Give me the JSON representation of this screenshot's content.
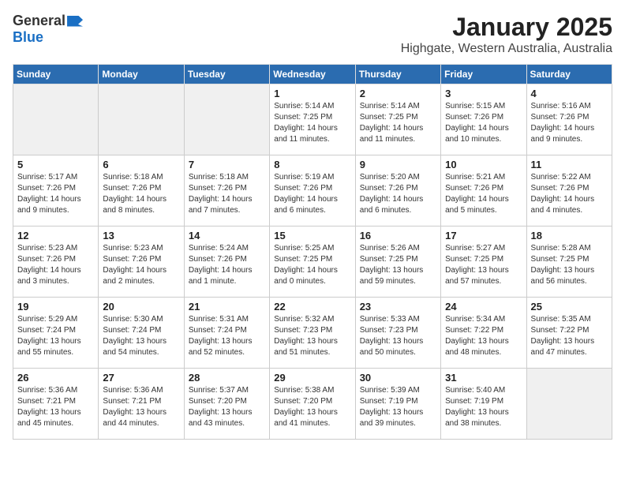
{
  "logo": {
    "general": "General",
    "blue": "Blue"
  },
  "header": {
    "month": "January 2025",
    "location": "Highgate, Western Australia, Australia"
  },
  "weekdays": [
    "Sunday",
    "Monday",
    "Tuesday",
    "Wednesday",
    "Thursday",
    "Friday",
    "Saturday"
  ],
  "weeks": [
    [
      {
        "day": "",
        "content": ""
      },
      {
        "day": "",
        "content": ""
      },
      {
        "day": "",
        "content": ""
      },
      {
        "day": "1",
        "content": "Sunrise: 5:14 AM\nSunset: 7:25 PM\nDaylight: 14 hours\nand 11 minutes."
      },
      {
        "day": "2",
        "content": "Sunrise: 5:14 AM\nSunset: 7:25 PM\nDaylight: 14 hours\nand 11 minutes."
      },
      {
        "day": "3",
        "content": "Sunrise: 5:15 AM\nSunset: 7:26 PM\nDaylight: 14 hours\nand 10 minutes."
      },
      {
        "day": "4",
        "content": "Sunrise: 5:16 AM\nSunset: 7:26 PM\nDaylight: 14 hours\nand 9 minutes."
      }
    ],
    [
      {
        "day": "5",
        "content": "Sunrise: 5:17 AM\nSunset: 7:26 PM\nDaylight: 14 hours\nand 9 minutes."
      },
      {
        "day": "6",
        "content": "Sunrise: 5:18 AM\nSunset: 7:26 PM\nDaylight: 14 hours\nand 8 minutes."
      },
      {
        "day": "7",
        "content": "Sunrise: 5:18 AM\nSunset: 7:26 PM\nDaylight: 14 hours\nand 7 minutes."
      },
      {
        "day": "8",
        "content": "Sunrise: 5:19 AM\nSunset: 7:26 PM\nDaylight: 14 hours\nand 6 minutes."
      },
      {
        "day": "9",
        "content": "Sunrise: 5:20 AM\nSunset: 7:26 PM\nDaylight: 14 hours\nand 6 minutes."
      },
      {
        "day": "10",
        "content": "Sunrise: 5:21 AM\nSunset: 7:26 PM\nDaylight: 14 hours\nand 5 minutes."
      },
      {
        "day": "11",
        "content": "Sunrise: 5:22 AM\nSunset: 7:26 PM\nDaylight: 14 hours\nand 4 minutes."
      }
    ],
    [
      {
        "day": "12",
        "content": "Sunrise: 5:23 AM\nSunset: 7:26 PM\nDaylight: 14 hours\nand 3 minutes."
      },
      {
        "day": "13",
        "content": "Sunrise: 5:23 AM\nSunset: 7:26 PM\nDaylight: 14 hours\nand 2 minutes."
      },
      {
        "day": "14",
        "content": "Sunrise: 5:24 AM\nSunset: 7:26 PM\nDaylight: 14 hours\nand 1 minute."
      },
      {
        "day": "15",
        "content": "Sunrise: 5:25 AM\nSunset: 7:25 PM\nDaylight: 14 hours\nand 0 minutes."
      },
      {
        "day": "16",
        "content": "Sunrise: 5:26 AM\nSunset: 7:25 PM\nDaylight: 13 hours\nand 59 minutes."
      },
      {
        "day": "17",
        "content": "Sunrise: 5:27 AM\nSunset: 7:25 PM\nDaylight: 13 hours\nand 57 minutes."
      },
      {
        "day": "18",
        "content": "Sunrise: 5:28 AM\nSunset: 7:25 PM\nDaylight: 13 hours\nand 56 minutes."
      }
    ],
    [
      {
        "day": "19",
        "content": "Sunrise: 5:29 AM\nSunset: 7:24 PM\nDaylight: 13 hours\nand 55 minutes."
      },
      {
        "day": "20",
        "content": "Sunrise: 5:30 AM\nSunset: 7:24 PM\nDaylight: 13 hours\nand 54 minutes."
      },
      {
        "day": "21",
        "content": "Sunrise: 5:31 AM\nSunset: 7:24 PM\nDaylight: 13 hours\nand 52 minutes."
      },
      {
        "day": "22",
        "content": "Sunrise: 5:32 AM\nSunset: 7:23 PM\nDaylight: 13 hours\nand 51 minutes."
      },
      {
        "day": "23",
        "content": "Sunrise: 5:33 AM\nSunset: 7:23 PM\nDaylight: 13 hours\nand 50 minutes."
      },
      {
        "day": "24",
        "content": "Sunrise: 5:34 AM\nSunset: 7:22 PM\nDaylight: 13 hours\nand 48 minutes."
      },
      {
        "day": "25",
        "content": "Sunrise: 5:35 AM\nSunset: 7:22 PM\nDaylight: 13 hours\nand 47 minutes."
      }
    ],
    [
      {
        "day": "26",
        "content": "Sunrise: 5:36 AM\nSunset: 7:21 PM\nDaylight: 13 hours\nand 45 minutes."
      },
      {
        "day": "27",
        "content": "Sunrise: 5:36 AM\nSunset: 7:21 PM\nDaylight: 13 hours\nand 44 minutes."
      },
      {
        "day": "28",
        "content": "Sunrise: 5:37 AM\nSunset: 7:20 PM\nDaylight: 13 hours\nand 43 minutes."
      },
      {
        "day": "29",
        "content": "Sunrise: 5:38 AM\nSunset: 7:20 PM\nDaylight: 13 hours\nand 41 minutes."
      },
      {
        "day": "30",
        "content": "Sunrise: 5:39 AM\nSunset: 7:19 PM\nDaylight: 13 hours\nand 39 minutes."
      },
      {
        "day": "31",
        "content": "Sunrise: 5:40 AM\nSunset: 7:19 PM\nDaylight: 13 hours\nand 38 minutes."
      },
      {
        "day": "",
        "content": ""
      }
    ]
  ]
}
